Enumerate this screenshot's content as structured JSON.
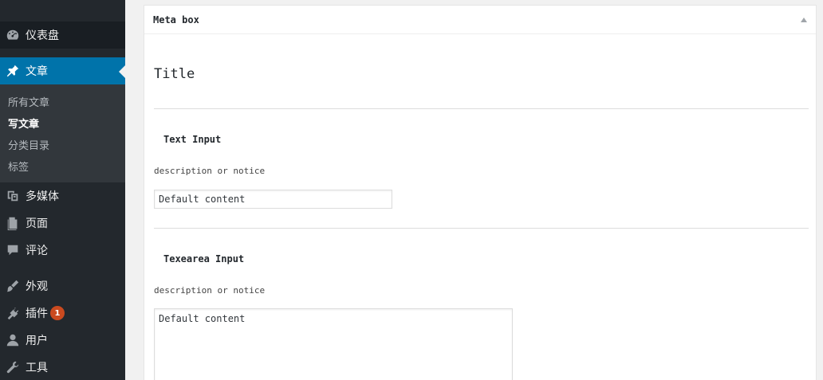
{
  "sidebar": {
    "dashboard": {
      "label": "仪表盘",
      "icon": "dashboard-icon"
    },
    "posts": {
      "label": "文章",
      "icon": "pin-icon"
    },
    "submenu": [
      "所有文章",
      "写文章",
      "分类目录",
      "标签"
    ],
    "media": {
      "label": "多媒体",
      "icon": "media-icon"
    },
    "pages": {
      "label": "页面",
      "icon": "page-icon"
    },
    "comments": {
      "label": "评论",
      "icon": "comment-icon"
    },
    "appearance": {
      "label": "外观",
      "icon": "brush-icon"
    },
    "plugins": {
      "label": "插件",
      "icon": "plugin-icon",
      "badge": "1"
    },
    "users": {
      "label": "用户",
      "icon": "user-icon"
    },
    "tools": {
      "label": "工具",
      "icon": "wrench-icon"
    }
  },
  "metabox": {
    "title": "Meta box",
    "section_title": "Title",
    "text_field": {
      "label": "Text Input",
      "description": "description or notice",
      "value": "Default content"
    },
    "textarea_field": {
      "label": "Texearea Input",
      "description": "description or notice",
      "value": "Default content"
    }
  },
  "colors": {
    "sidebar_bg": "#23282d",
    "active_bg": "#0073aa",
    "badge_bg": "#ca4a1f"
  }
}
